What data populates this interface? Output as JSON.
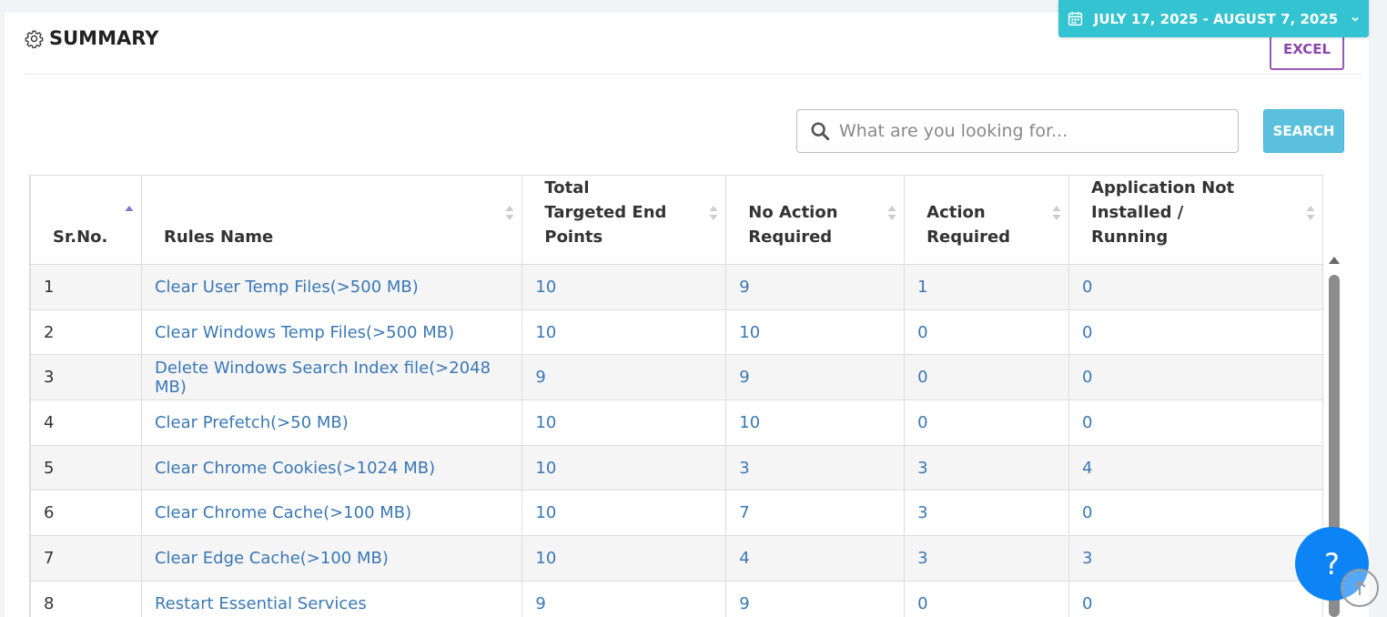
{
  "header": {
    "title": "SUMMARY",
    "date_range": "JULY 17, 2025 - AUGUST 7, 2025",
    "excel_label": "EXCEL"
  },
  "search": {
    "placeholder": "What are you looking for...",
    "button_label": "SEARCH"
  },
  "table": {
    "columns": [
      "Sr.No.",
      "Rules Name",
      "Total Targeted End Points",
      "No Action Required",
      "Action Required",
      "Application Not Installed / Running"
    ],
    "rows": [
      {
        "sr": "1",
        "rule": "Clear User Temp Files(>500 MB)",
        "total": "10",
        "no_action": "9",
        "action": "1",
        "app_not_installed": "0"
      },
      {
        "sr": "2",
        "rule": "Clear Windows Temp Files(>500 MB)",
        "total": "10",
        "no_action": "10",
        "action": "0",
        "app_not_installed": "0"
      },
      {
        "sr": "3",
        "rule": "Delete Windows Search Index file(>2048 MB)",
        "total": "9",
        "no_action": "9",
        "action": "0",
        "app_not_installed": "0"
      },
      {
        "sr": "4",
        "rule": "Clear Prefetch(>50 MB)",
        "total": "10",
        "no_action": "10",
        "action": "0",
        "app_not_installed": "0"
      },
      {
        "sr": "5",
        "rule": "Clear Chrome Cookies(>1024 MB)",
        "total": "10",
        "no_action": "3",
        "action": "3",
        "app_not_installed": "4"
      },
      {
        "sr": "6",
        "rule": "Clear Chrome Cache(>100 MB)",
        "total": "10",
        "no_action": "7",
        "action": "3",
        "app_not_installed": "0"
      },
      {
        "sr": "7",
        "rule": "Clear Edge Cache(>100 MB)",
        "total": "10",
        "no_action": "4",
        "action": "3",
        "app_not_installed": "3"
      },
      {
        "sr": "8",
        "rule": "Restart Essential Services",
        "total": "9",
        "no_action": "9",
        "action": "0",
        "app_not_installed": "0"
      }
    ]
  },
  "help": {
    "label": "?"
  },
  "colors": {
    "date_button": "#33c3d1",
    "excel_border": "#9c59b6",
    "search_button": "#5bc0de",
    "link_text": "#3a78b5",
    "help_button": "#0d84f5"
  },
  "icons": {
    "title": "gear-icon",
    "date": "calendar-icon",
    "date_toggle": "chevron-down-icon",
    "search": "search-icon",
    "sort": "sort-icon",
    "scroll_top": "arrow-up-circle-icon"
  }
}
